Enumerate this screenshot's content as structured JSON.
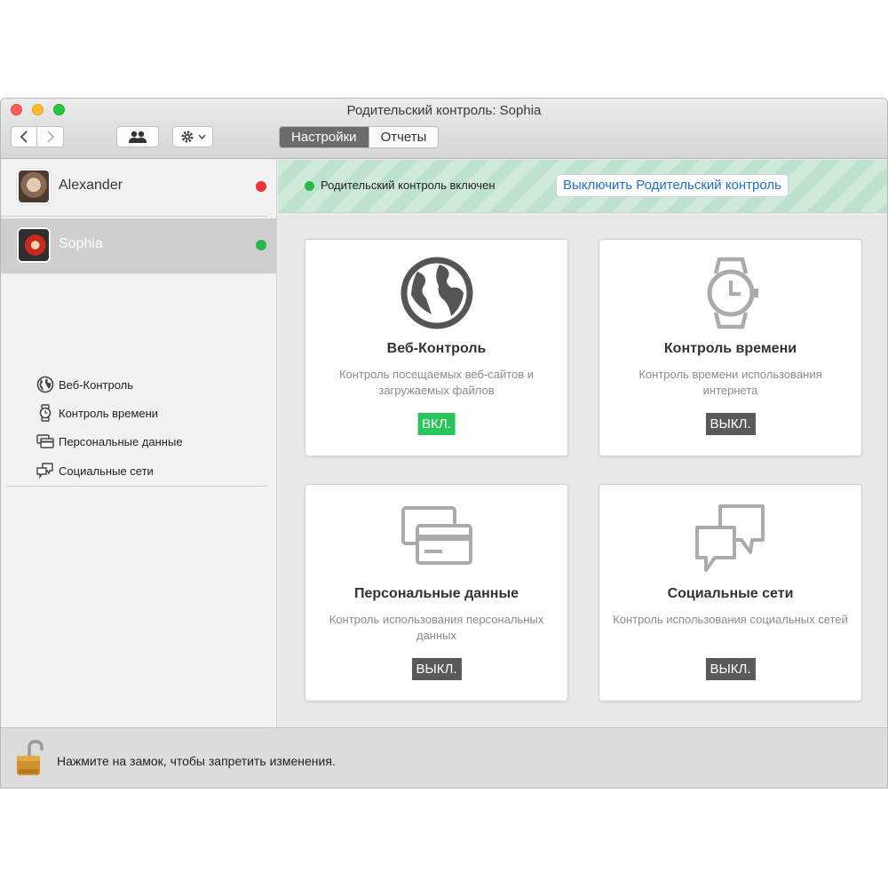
{
  "window": {
    "title": "Родительский контроль: Sophia"
  },
  "toolbar": {
    "tabs": [
      {
        "label": "Настройки",
        "active": true
      },
      {
        "label": "Отчеты",
        "active": false
      }
    ]
  },
  "sidebar": {
    "users": [
      {
        "name": "Alexander",
        "status_color": "#e8343a"
      },
      {
        "name": "Sophia",
        "status_color": "#29b948",
        "selected": true
      }
    ],
    "items": [
      {
        "label": "Веб-Контроль",
        "icon": "globe-icon"
      },
      {
        "label": "Контроль времени",
        "icon": "watch-icon"
      },
      {
        "label": "Персональные данные",
        "icon": "cards-icon"
      },
      {
        "label": "Социальные сети",
        "icon": "chat-bubbles-icon"
      }
    ]
  },
  "banner": {
    "status_text": "Родительский контроль включен",
    "status_color": "#29b948",
    "button_label": "Выключить Родительский контроль"
  },
  "cards": [
    {
      "title": "Веб-Контроль",
      "description": "Контроль посещаемых веб-сайтов и загружаемых файлов",
      "state": "ВКЛ.",
      "icon": "globe-icon"
    },
    {
      "title": "Контроль времени",
      "description": "Контроль времени использования интернета",
      "state": "ВЫКЛ.",
      "icon": "watch-icon"
    },
    {
      "title": "Персональные данные",
      "description": "Контроль использования персональных данных",
      "state": "ВЫКЛ.",
      "icon": "cards-icon"
    },
    {
      "title": "Социальные сети",
      "description": "Контроль использования социальных сетей",
      "state": "ВЫКЛ.",
      "icon": "chat-bubbles-icon"
    }
  ],
  "footer": {
    "lock_text": "Нажмите на замок, чтобы запретить изменения."
  },
  "colors": {
    "accent_blue": "#1f6fd1",
    "on_green": "#27c55c",
    "off_gray": "#5a5a5a"
  }
}
